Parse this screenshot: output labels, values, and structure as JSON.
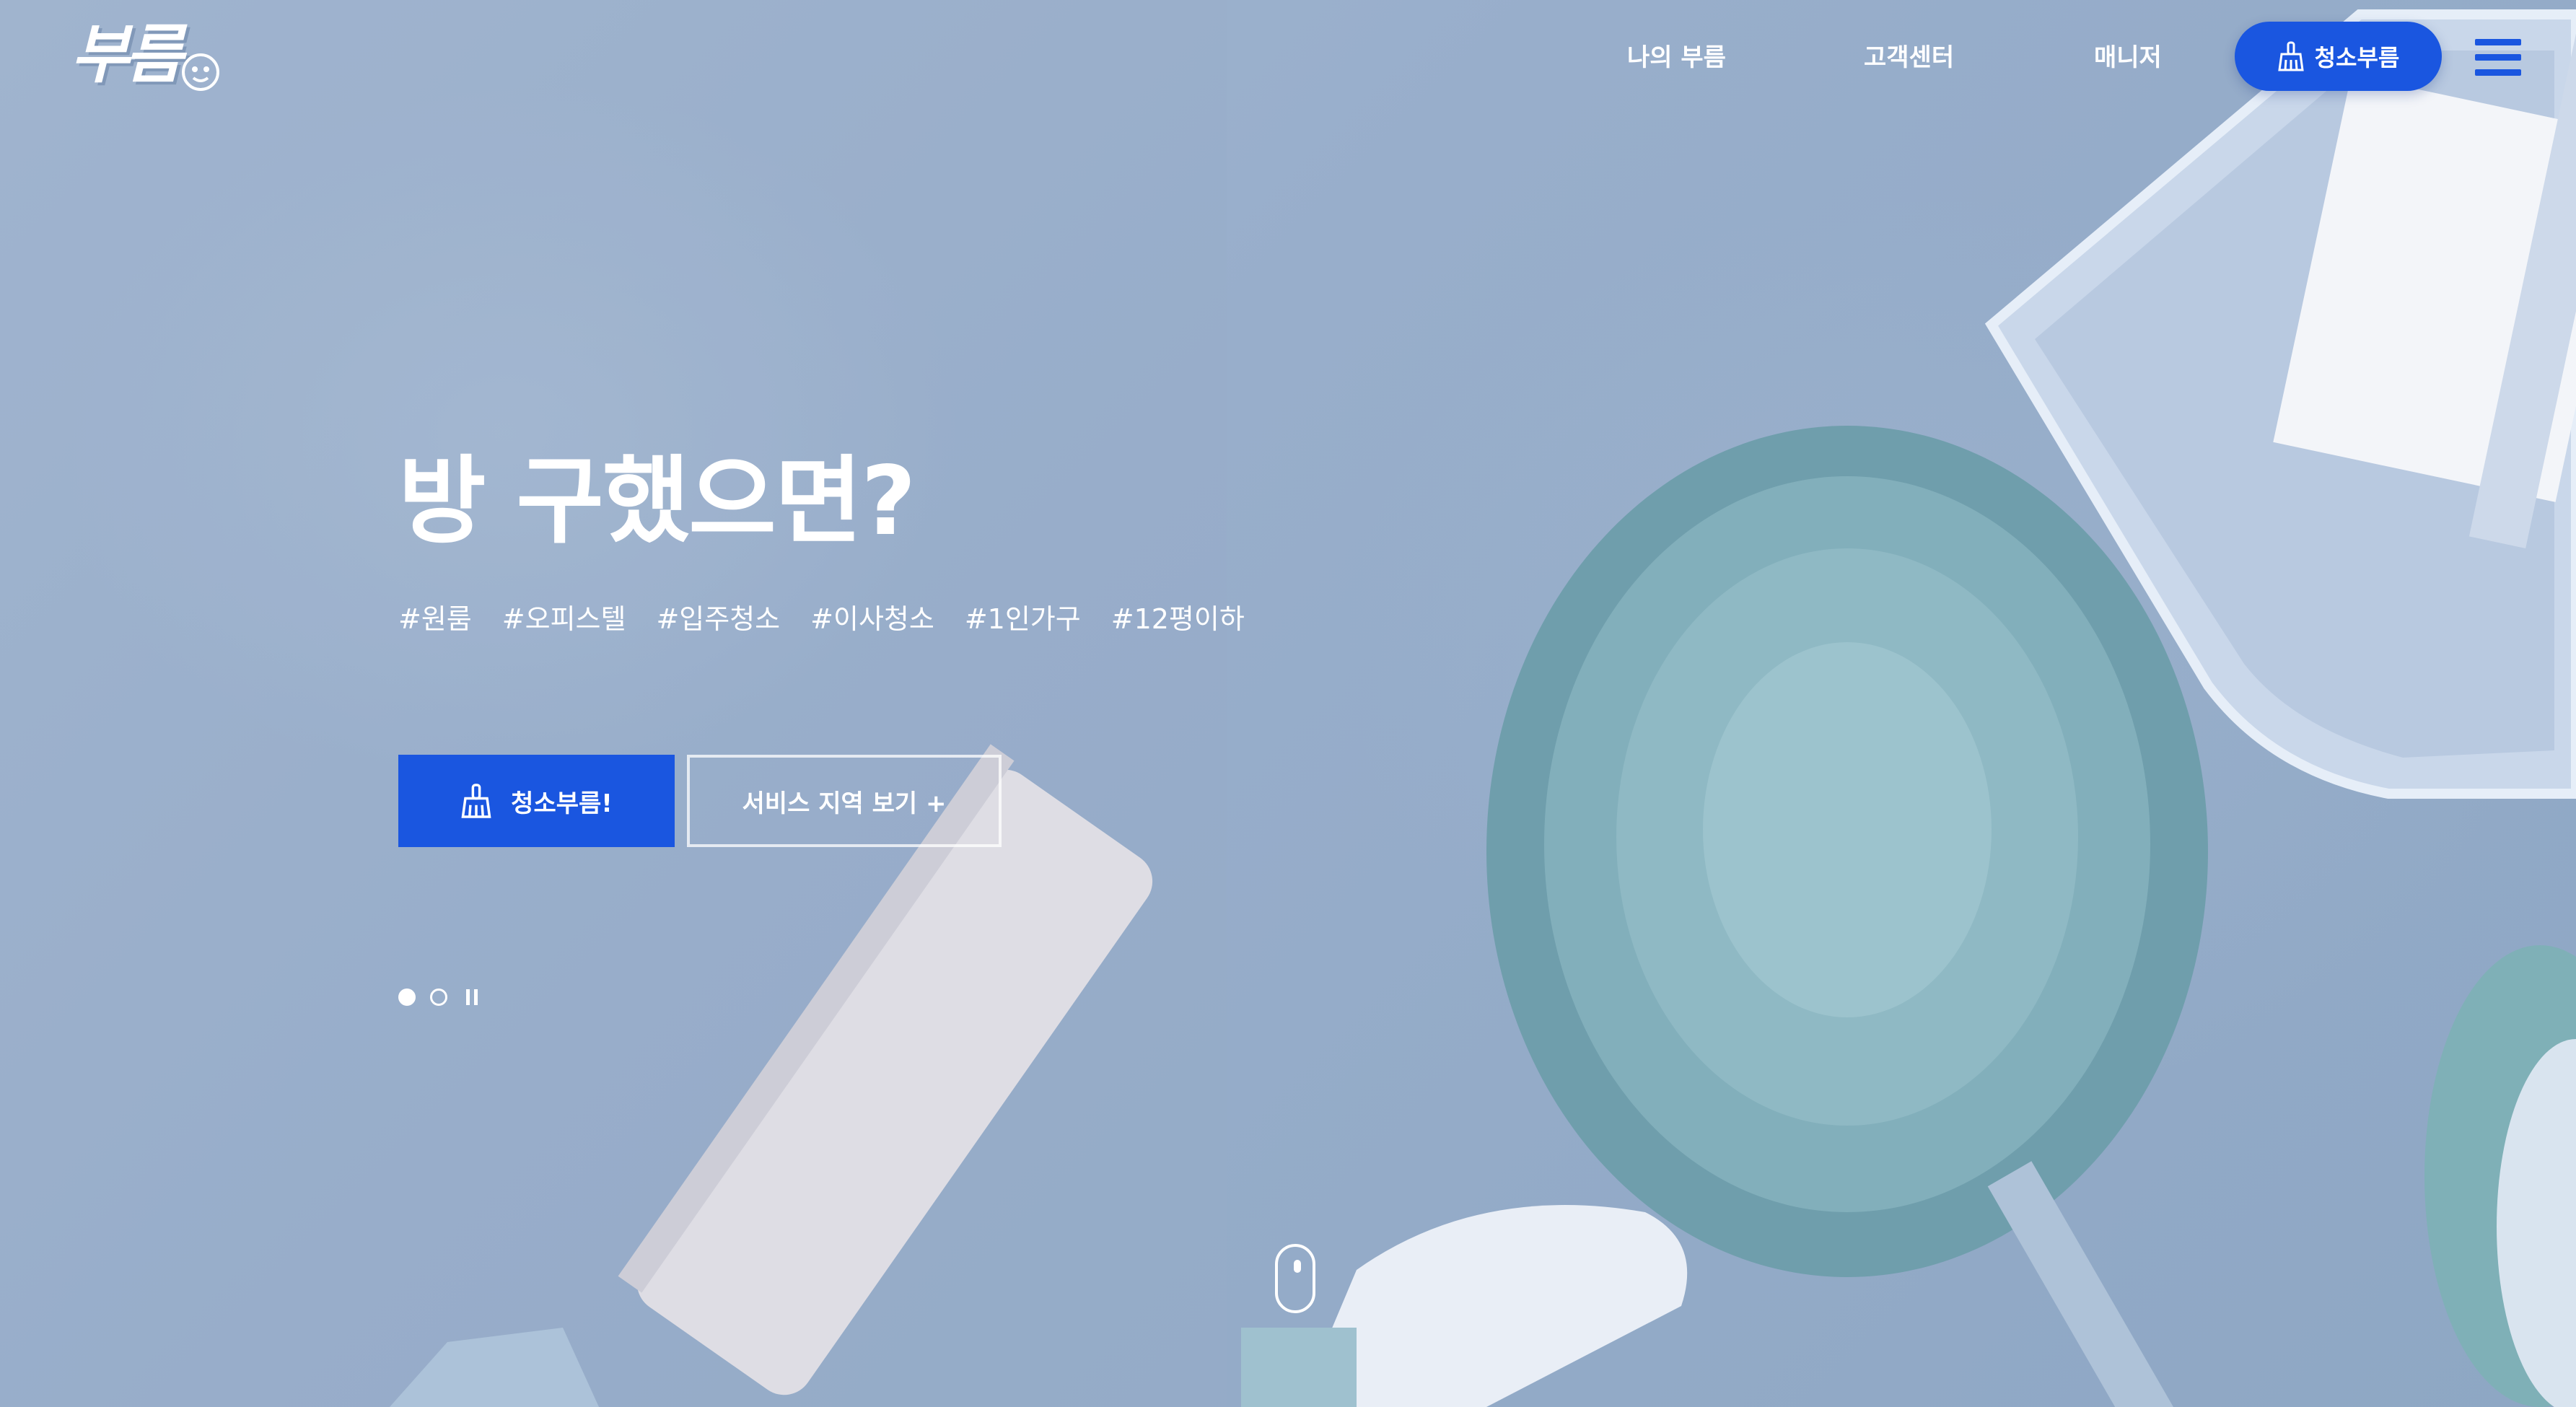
{
  "header": {
    "logo_text": "부름",
    "nav": [
      {
        "label": "나의 부름"
      },
      {
        "label": "고객센터"
      },
      {
        "label": "매니저"
      }
    ],
    "cta_label": "청소부름"
  },
  "hero": {
    "title": "방 구했으면?",
    "tags": [
      "#원룸",
      "#오피스텔",
      "#입주청소",
      "#이사청소",
      "#1인가구",
      "#12평이하"
    ],
    "primary_button": "청소부름!",
    "secondary_button": "서비스 지역 보기 +"
  },
  "slider": {
    "total_slides": 2,
    "active_slide": 1
  },
  "colors": {
    "brand_blue": "#1a56e0",
    "background": "#98aecb",
    "text": "#ffffff"
  },
  "icons": {
    "cta_icon": "broom-icon",
    "menu_icon": "hamburger-menu-icon",
    "scroll_icon": "mouse-scroll-icon"
  }
}
